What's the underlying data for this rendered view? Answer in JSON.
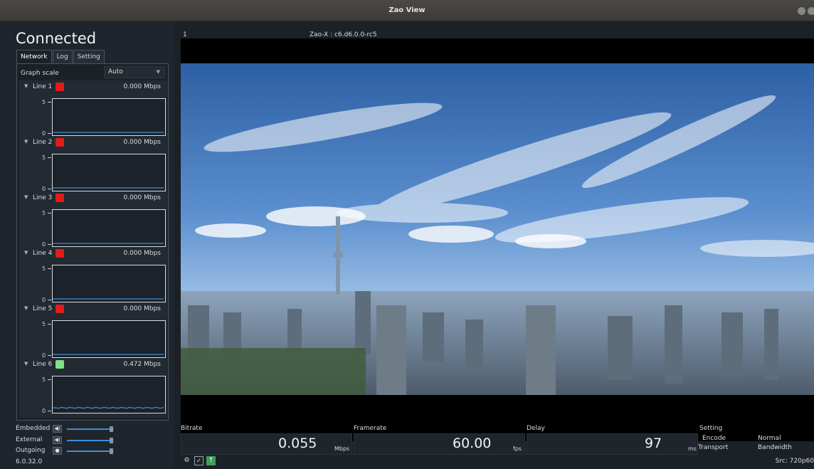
{
  "window": {
    "title": "Zao View"
  },
  "sidebar": {
    "status": "Connected",
    "tabs": [
      {
        "label": "Network",
        "active": true
      },
      {
        "label": "Log",
        "active": false
      },
      {
        "label": "Setting",
        "active": false
      }
    ],
    "graph_scale": {
      "label": "Graph scale",
      "value": "Auto"
    },
    "lines": [
      {
        "name": "Line 1",
        "status_color": "#e31b1b",
        "rate": "0.000 Mbps",
        "ymax": "5",
        "ymin": "0",
        "level": 0.02
      },
      {
        "name": "Line 2",
        "status_color": "#e31b1b",
        "rate": "0.000 Mbps",
        "ymax": "5",
        "ymin": "0",
        "level": 0.02
      },
      {
        "name": "Line 3",
        "status_color": "#e31b1b",
        "rate": "0.000 Mbps",
        "ymax": "5",
        "ymin": "0",
        "level": 0.02
      },
      {
        "name": "Line 4",
        "status_color": "#e31b1b",
        "rate": "0.000 Mbps",
        "ymax": "5",
        "ymin": "0",
        "level": 0.02
      },
      {
        "name": "Line 5",
        "status_color": "#e31b1b",
        "rate": "0.000 Mbps",
        "ymax": "5",
        "ymin": "0",
        "level": 0.02
      },
      {
        "name": "Line 6",
        "status_color": "#7fe08a",
        "rate": "0.472 Mbps",
        "ymax": "5",
        "ymin": "0",
        "level": 0.09
      }
    ],
    "audio": [
      {
        "label": "Embedded",
        "icon": "speaker-icon",
        "level": 0.95
      },
      {
        "label": "External",
        "icon": "speaker-icon",
        "level": 0.95
      },
      {
        "label": "Outgoing",
        "icon": "microphone-icon",
        "level": 0.95
      }
    ],
    "version": "6.0.32.0"
  },
  "video": {
    "channel": "1",
    "device": "Zao-X : c6.d6.0.0-rc5"
  },
  "stats": {
    "bitrate": {
      "label": "Bitrate",
      "value": "0.055",
      "unit": "Mbps"
    },
    "framerate": {
      "label": "Framerate",
      "value": "60.00",
      "unit": "fps"
    },
    "delay": {
      "label": "Delay",
      "value": "97",
      "unit": "ms"
    },
    "setting": {
      "label": "Setting",
      "encode_label": "Encode",
      "encode_value": "Normal",
      "transport_label": "Transport",
      "transport_value": "Bandwidth"
    },
    "source": "Src: 720p60"
  },
  "colors": {
    "accent": "#3d8fd8",
    "background": "#1b2127",
    "trace": "#3d8fd8"
  }
}
